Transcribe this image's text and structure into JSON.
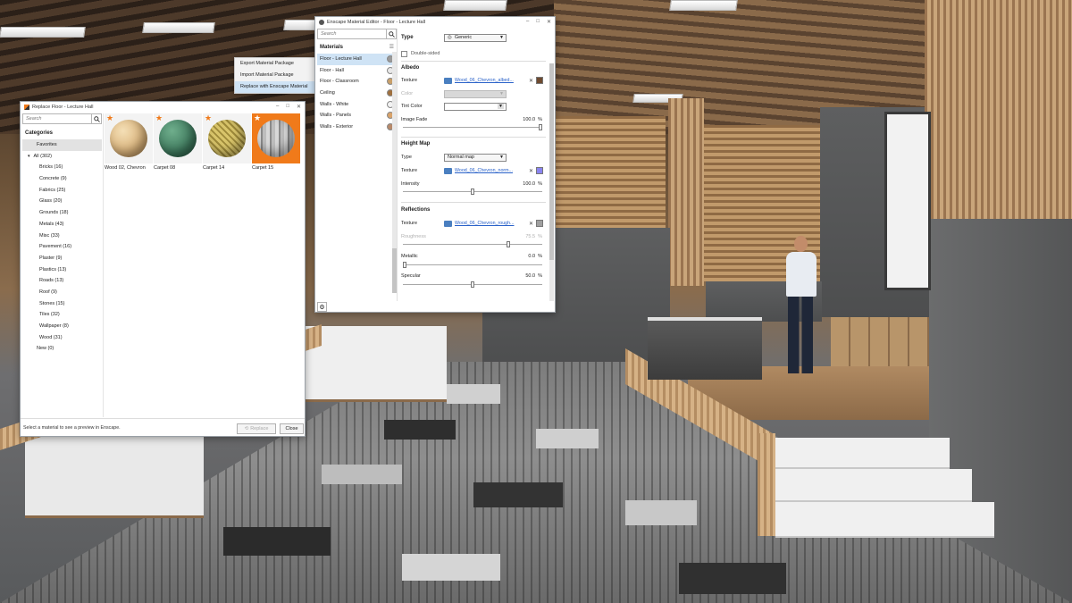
{
  "replace_window": {
    "title": "Replace Floor - Lecture Hall",
    "search_placeholder": "Search",
    "categories_title": "Categories",
    "favorites": "Favorites",
    "all": "All (302)",
    "categories": [
      "Bricks (16)",
      "Concrete (9)",
      "Fabrics (25)",
      "Glass (20)",
      "Grounds (18)",
      "Metals (43)",
      "Misc (33)",
      "Pavement (16)",
      "Plaster (9)",
      "Plastics (13)",
      "Roads (13)",
      "Roof (9)",
      "Stones (15)",
      "Tiles (32)",
      "Wallpaper (8)",
      "Wood (31)"
    ],
    "new": "New (0)",
    "thumbnails": [
      {
        "label": "Wood 02, Chevron",
        "color": "#e3c48f",
        "selected": false
      },
      {
        "label": "Carpet 08",
        "color": "#3f7a5e",
        "selected": false
      },
      {
        "label": "Carpet 14",
        "color": "#c9b35a",
        "selected": false
      },
      {
        "label": "Carpet 15",
        "color": "#9c9c9c",
        "selected": true
      }
    ],
    "status": "Select a material to see a preview in Enscape.",
    "replace_button": "Replace",
    "close_button": "Close"
  },
  "context_menu": {
    "items": [
      "Export Material Package",
      "Import Material Package",
      "Replace with Enscape Material"
    ],
    "highlighted_index": 2
  },
  "editor": {
    "title": "Enscape Material Editor - Floor - Lecture Hall",
    "search_placeholder": "Search",
    "materials_title": "Materials",
    "materials": [
      {
        "name": "Floor - Lecture Hall",
        "color": "#9a9a9a",
        "selected": true
      },
      {
        "name": "Floor - Hall",
        "color": "#e8e8e8",
        "selected": false
      },
      {
        "name": "Floor - Classroom",
        "color": "#c9a06a",
        "selected": false
      },
      {
        "name": "Ceiling",
        "color": "#a0703e",
        "selected": false
      },
      {
        "name": "Walls - White",
        "color": "#f2f2f2",
        "selected": false
      },
      {
        "name": "Walls - Panels",
        "color": "#d9a36a",
        "selected": false
      },
      {
        "name": "Walls - Exterior",
        "color": "#b88a6a",
        "selected": false
      }
    ],
    "type_label": "Type",
    "type_value": "Generic",
    "double_sided": "Double-sided",
    "albedo": {
      "title": "Albedo",
      "texture_label": "Texture",
      "texture_file": "Wood_06_Chevron_albed...",
      "texture_swatch": "#6e4a30",
      "color_label": "Color",
      "tint_label": "Tint Color",
      "image_fade_label": "Image Fade",
      "image_fade_value": "100.0",
      "image_fade_unit": "%",
      "image_fade_fraction": 1.0
    },
    "heightmap": {
      "title": "Height Map",
      "type_label": "Type",
      "type_value": "Normal map",
      "texture_label": "Texture",
      "texture_file": "Wood_06_Chevron_norm...",
      "texture_swatch": "#8a84f0",
      "intensity_label": "Intensity",
      "intensity_value": "100.0",
      "intensity_unit": "%",
      "intensity_fraction": 0.5
    },
    "reflections": {
      "title": "Reflections",
      "texture_label": "Texture",
      "texture_file": "Wood_06_Chevron_rough...",
      "texture_swatch": "#a0a0a0",
      "roughness_label": "Roughness",
      "roughness_value": "75.5",
      "roughness_fraction": 0.755,
      "metallic_label": "Metallic",
      "metallic_value": "0.0",
      "metallic_fraction": 0.0,
      "specular_label": "Specular",
      "specular_value": "50.0",
      "specular_fraction": 0.5,
      "unit": "%"
    }
  },
  "icons": {
    "search": "search-icon",
    "star": "star-icon",
    "gear": "gear-icon",
    "close": "close-icon",
    "folder": "folder-icon"
  },
  "accent": "#f07a1a",
  "selection": "#cfe3f5"
}
